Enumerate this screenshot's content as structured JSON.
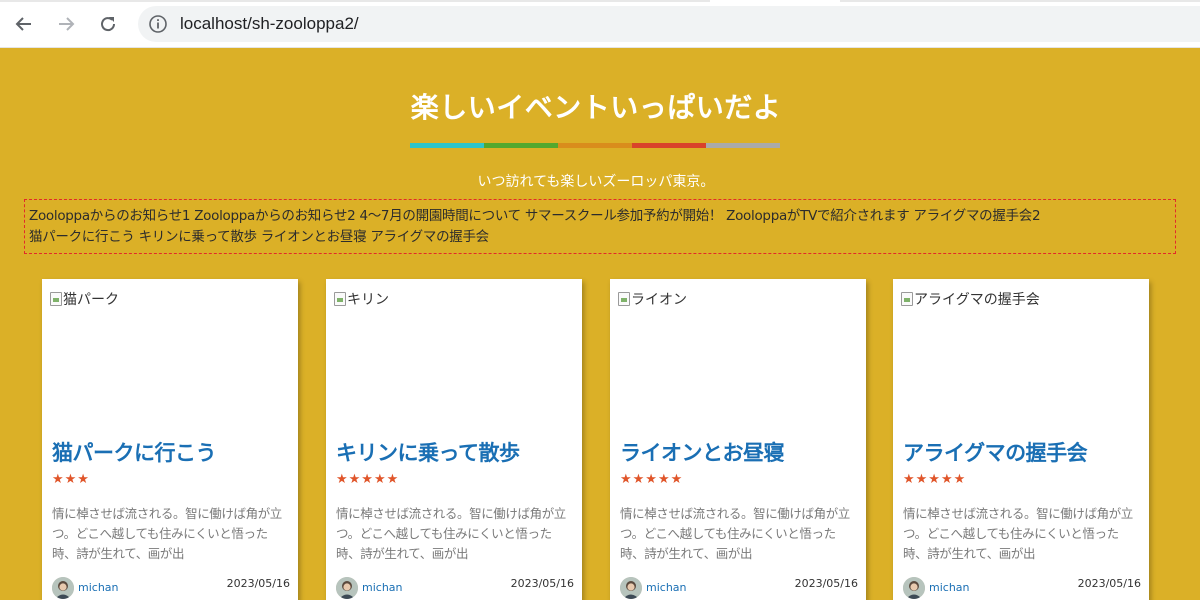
{
  "browser": {
    "url": "localhost/sh-zooloppa2/",
    "back_icon": "arrow-left-icon",
    "forward_icon": "arrow-right-icon",
    "reload_icon": "reload-icon",
    "info_icon": "info-icon"
  },
  "header": {
    "title": "楽しいイベントいっぱいだよ",
    "subtitle": "いつ訪れても楽しいズーロッパ東京。",
    "divider_colors": [
      "#2ec4c9",
      "#53a82e",
      "#d98d1c",
      "#d9432a",
      "#aaaaaa"
    ]
  },
  "news": {
    "items": [
      "Zooloppaからのお知らせ1",
      "Zooloppaからのお知らせ2",
      "4〜7月の開園時間について",
      "サマースクール参加予約が開始！",
      "ZooloppaがTVで紹介されます",
      "アライグマの握手会2",
      "猫パークに行こう",
      "キリンに乗って散歩",
      "ライオンとお昼寝",
      "アライグマの握手会"
    ]
  },
  "cards": [
    {
      "image_alt": "猫パーク",
      "title": "猫パークに行こう",
      "stars": "★★★",
      "rating": 3,
      "excerpt": "情に棹させば流される。智に働けば角が立つ。どこへ越しても住みにくいと悟った時、詩が生れて、画が出",
      "author": "michan",
      "date": "2023/05/16"
    },
    {
      "image_alt": "キリン",
      "title": "キリンに乗って散歩",
      "stars": "★★★★★",
      "rating": 5,
      "excerpt": "情に棹させば流される。智に働けば角が立つ。どこへ越しても住みにくいと悟った時、詩が生れて、画が出",
      "author": "michan",
      "date": "2023/05/16"
    },
    {
      "image_alt": "ライオン",
      "title": "ライオンとお昼寝",
      "stars": "★★★★★",
      "rating": 5,
      "excerpt": "情に棹させば流される。智に働けば角が立つ。どこへ越しても住みにくいと悟った時、詩が生れて、画が出",
      "author": "michan",
      "date": "2023/05/16"
    },
    {
      "image_alt": "アライグマの握手会",
      "title": "アライグマの握手会",
      "stars": "★★★★★",
      "rating": 5,
      "excerpt": "情に棹させば流される。智に働けば角が立つ。どこへ越しても住みにくいと悟った時、詩が生れて、画が出",
      "author": "michan",
      "date": "2023/05/16"
    }
  ],
  "colors": {
    "background": "#dbb027",
    "title_link": "#1a6fb4",
    "star": "#e0552a",
    "news_border": "#e22a2a"
  }
}
